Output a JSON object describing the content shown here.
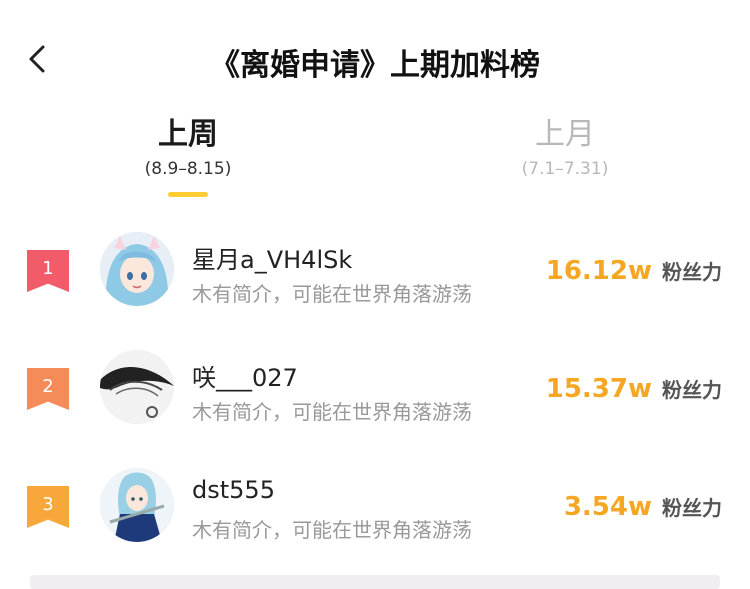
{
  "header": {
    "title": "《离婚申请》上期加料榜"
  },
  "tabs": [
    {
      "label": "上周",
      "range": "(8.9–8.15)",
      "active": true
    },
    {
      "label": "上月",
      "range": "(7.1–7.31)",
      "active": false
    }
  ],
  "colors": {
    "accent": "#ffcc33",
    "fans_number": "#f5a623",
    "rank1": "#f25c6a",
    "rank2": "#f68b5a",
    "rank3": "#f8a83a"
  },
  "list": [
    {
      "rank": "1",
      "name": "星月a_VH4lSk",
      "bio": "木有简介，可能在世界角落游荡",
      "fans": "16.12w",
      "fans_label": "粉丝力"
    },
    {
      "rank": "2",
      "name": "咲___027",
      "bio": "木有简介，可能在世界角落游荡",
      "fans": "15.37w",
      "fans_label": "粉丝力"
    },
    {
      "rank": "3",
      "name": "dst555",
      "bio": "木有简介，可能在世界角落游荡",
      "fans": "3.54w",
      "fans_label": "粉丝力"
    }
  ]
}
